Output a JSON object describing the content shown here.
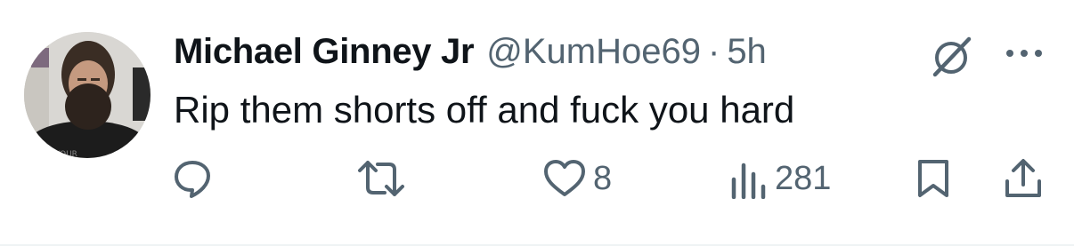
{
  "tweet": {
    "author": {
      "display_name": "Michael Ginney Jr",
      "handle": "@KumHoe69"
    },
    "separator": "·",
    "timestamp": "5h",
    "text": "Rip them shorts off and fuck you hard",
    "icons": {
      "header": [
        "grok-icon",
        "more-icon"
      ],
      "actions": [
        "reply-icon",
        "retweet-icon",
        "like-icon",
        "views-icon",
        "bookmark-icon",
        "share-icon"
      ]
    },
    "stats": {
      "likes": "8",
      "views": "281"
    }
  },
  "colors": {
    "text_primary": "#0f1419",
    "text_secondary": "#536471",
    "background": "#ffffff"
  }
}
